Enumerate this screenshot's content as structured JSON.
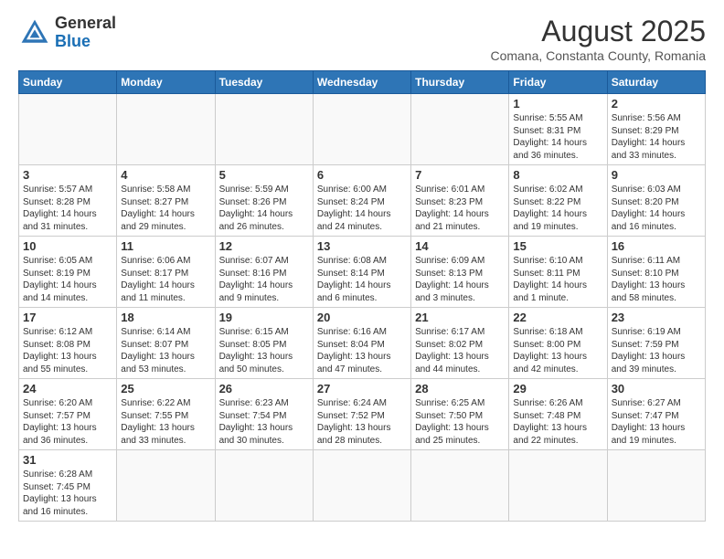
{
  "header": {
    "logo_general": "General",
    "logo_blue": "Blue",
    "month_year": "August 2025",
    "location": "Comana, Constanta County, Romania"
  },
  "weekdays": [
    "Sunday",
    "Monday",
    "Tuesday",
    "Wednesday",
    "Thursday",
    "Friday",
    "Saturday"
  ],
  "weeks": [
    [
      {
        "day": "",
        "info": ""
      },
      {
        "day": "",
        "info": ""
      },
      {
        "day": "",
        "info": ""
      },
      {
        "day": "",
        "info": ""
      },
      {
        "day": "",
        "info": ""
      },
      {
        "day": "1",
        "info": "Sunrise: 5:55 AM\nSunset: 8:31 PM\nDaylight: 14 hours and 36 minutes."
      },
      {
        "day": "2",
        "info": "Sunrise: 5:56 AM\nSunset: 8:29 PM\nDaylight: 14 hours and 33 minutes."
      }
    ],
    [
      {
        "day": "3",
        "info": "Sunrise: 5:57 AM\nSunset: 8:28 PM\nDaylight: 14 hours and 31 minutes."
      },
      {
        "day": "4",
        "info": "Sunrise: 5:58 AM\nSunset: 8:27 PM\nDaylight: 14 hours and 29 minutes."
      },
      {
        "day": "5",
        "info": "Sunrise: 5:59 AM\nSunset: 8:26 PM\nDaylight: 14 hours and 26 minutes."
      },
      {
        "day": "6",
        "info": "Sunrise: 6:00 AM\nSunset: 8:24 PM\nDaylight: 14 hours and 24 minutes."
      },
      {
        "day": "7",
        "info": "Sunrise: 6:01 AM\nSunset: 8:23 PM\nDaylight: 14 hours and 21 minutes."
      },
      {
        "day": "8",
        "info": "Sunrise: 6:02 AM\nSunset: 8:22 PM\nDaylight: 14 hours and 19 minutes."
      },
      {
        "day": "9",
        "info": "Sunrise: 6:03 AM\nSunset: 8:20 PM\nDaylight: 14 hours and 16 minutes."
      }
    ],
    [
      {
        "day": "10",
        "info": "Sunrise: 6:05 AM\nSunset: 8:19 PM\nDaylight: 14 hours and 14 minutes."
      },
      {
        "day": "11",
        "info": "Sunrise: 6:06 AM\nSunset: 8:17 PM\nDaylight: 14 hours and 11 minutes."
      },
      {
        "day": "12",
        "info": "Sunrise: 6:07 AM\nSunset: 8:16 PM\nDaylight: 14 hours and 9 minutes."
      },
      {
        "day": "13",
        "info": "Sunrise: 6:08 AM\nSunset: 8:14 PM\nDaylight: 14 hours and 6 minutes."
      },
      {
        "day": "14",
        "info": "Sunrise: 6:09 AM\nSunset: 8:13 PM\nDaylight: 14 hours and 3 minutes."
      },
      {
        "day": "15",
        "info": "Sunrise: 6:10 AM\nSunset: 8:11 PM\nDaylight: 14 hours and 1 minute."
      },
      {
        "day": "16",
        "info": "Sunrise: 6:11 AM\nSunset: 8:10 PM\nDaylight: 13 hours and 58 minutes."
      }
    ],
    [
      {
        "day": "17",
        "info": "Sunrise: 6:12 AM\nSunset: 8:08 PM\nDaylight: 13 hours and 55 minutes."
      },
      {
        "day": "18",
        "info": "Sunrise: 6:14 AM\nSunset: 8:07 PM\nDaylight: 13 hours and 53 minutes."
      },
      {
        "day": "19",
        "info": "Sunrise: 6:15 AM\nSunset: 8:05 PM\nDaylight: 13 hours and 50 minutes."
      },
      {
        "day": "20",
        "info": "Sunrise: 6:16 AM\nSunset: 8:04 PM\nDaylight: 13 hours and 47 minutes."
      },
      {
        "day": "21",
        "info": "Sunrise: 6:17 AM\nSunset: 8:02 PM\nDaylight: 13 hours and 44 minutes."
      },
      {
        "day": "22",
        "info": "Sunrise: 6:18 AM\nSunset: 8:00 PM\nDaylight: 13 hours and 42 minutes."
      },
      {
        "day": "23",
        "info": "Sunrise: 6:19 AM\nSunset: 7:59 PM\nDaylight: 13 hours and 39 minutes."
      }
    ],
    [
      {
        "day": "24",
        "info": "Sunrise: 6:20 AM\nSunset: 7:57 PM\nDaylight: 13 hours and 36 minutes."
      },
      {
        "day": "25",
        "info": "Sunrise: 6:22 AM\nSunset: 7:55 PM\nDaylight: 13 hours and 33 minutes."
      },
      {
        "day": "26",
        "info": "Sunrise: 6:23 AM\nSunset: 7:54 PM\nDaylight: 13 hours and 30 minutes."
      },
      {
        "day": "27",
        "info": "Sunrise: 6:24 AM\nSunset: 7:52 PM\nDaylight: 13 hours and 28 minutes."
      },
      {
        "day": "28",
        "info": "Sunrise: 6:25 AM\nSunset: 7:50 PM\nDaylight: 13 hours and 25 minutes."
      },
      {
        "day": "29",
        "info": "Sunrise: 6:26 AM\nSunset: 7:48 PM\nDaylight: 13 hours and 22 minutes."
      },
      {
        "day": "30",
        "info": "Sunrise: 6:27 AM\nSunset: 7:47 PM\nDaylight: 13 hours and 19 minutes."
      }
    ],
    [
      {
        "day": "31",
        "info": "Sunrise: 6:28 AM\nSunset: 7:45 PM\nDaylight: 13 hours and 16 minutes."
      },
      {
        "day": "",
        "info": ""
      },
      {
        "day": "",
        "info": ""
      },
      {
        "day": "",
        "info": ""
      },
      {
        "day": "",
        "info": ""
      },
      {
        "day": "",
        "info": ""
      },
      {
        "day": "",
        "info": ""
      }
    ]
  ]
}
